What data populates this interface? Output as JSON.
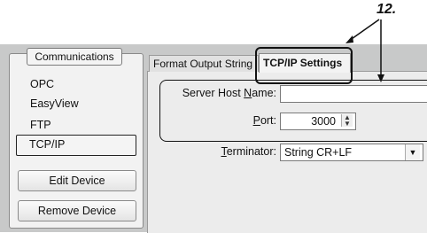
{
  "annotation": {
    "callout_number": "12."
  },
  "sidebar": {
    "group_title": "Communications",
    "items": [
      {
        "label": "OPC"
      },
      {
        "label": "EasyView"
      },
      {
        "label": "FTP"
      },
      {
        "label": "TCP/IP",
        "selected": true
      }
    ],
    "edit_device_label": "Edit Device",
    "remove_device_label": "Remove Device"
  },
  "tabs": [
    {
      "label": "Format Output String",
      "active": false
    },
    {
      "label": "TCP/IP Settings",
      "active": true
    }
  ],
  "form": {
    "host": {
      "label_pre": "Server Host ",
      "label_access": "N",
      "label_post": "ame:",
      "value": ""
    },
    "port": {
      "label_access": "P",
      "label_post": "ort:",
      "value": "3000"
    },
    "terminator": {
      "label_access": "T",
      "label_post": "erminator:",
      "value": "String CR+LF"
    }
  }
}
